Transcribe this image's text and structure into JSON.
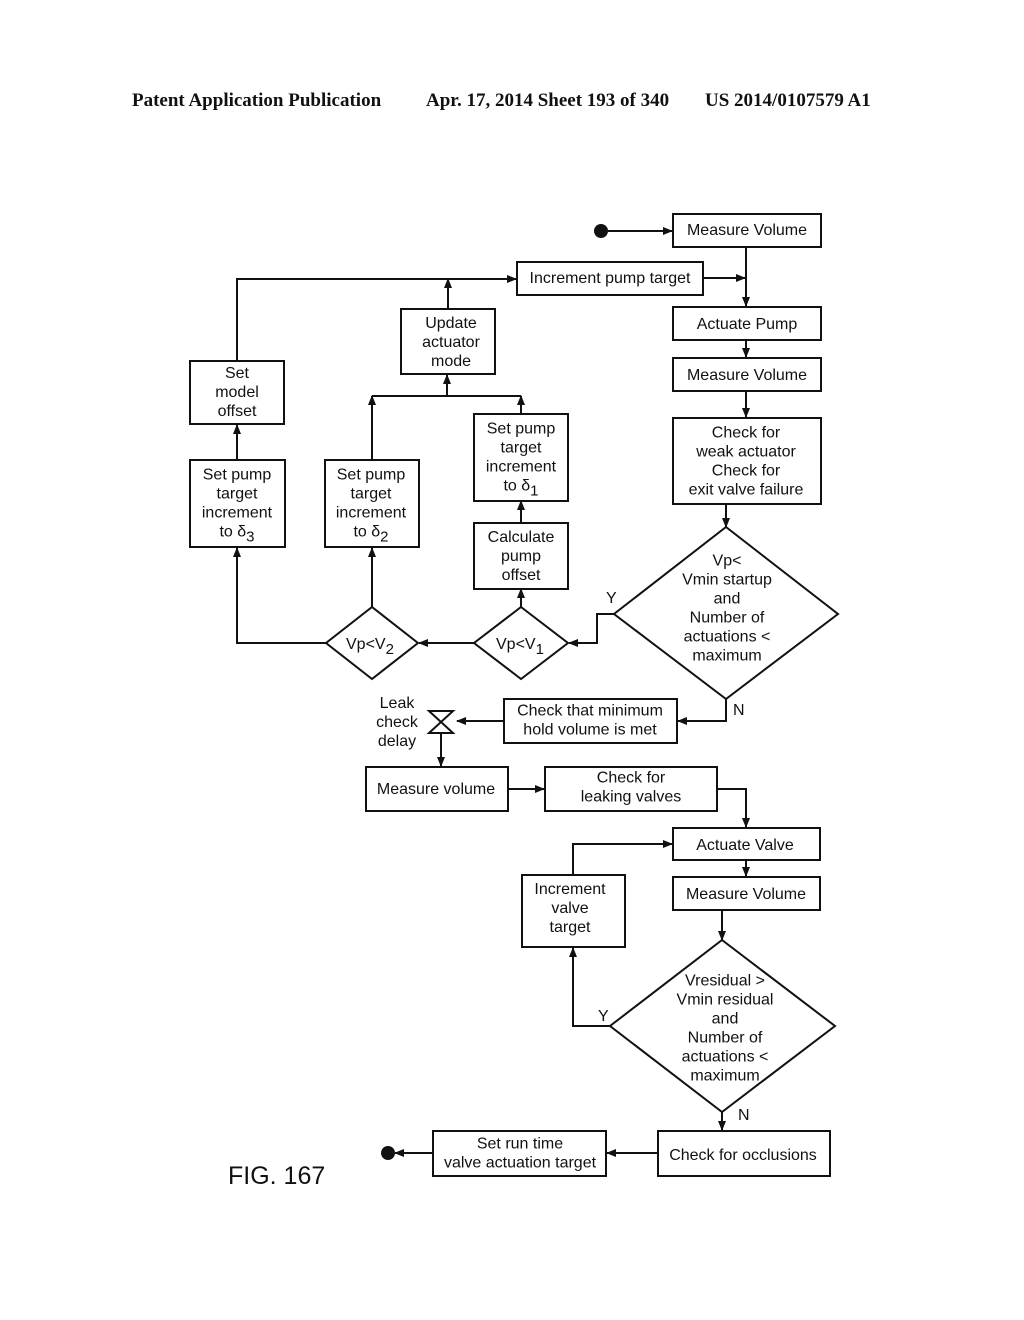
{
  "header": {
    "publication": "Patent Application Publication",
    "date_sheet": "Apr. 17, 2014  Sheet 193 of 340",
    "number": "US 2014/0107579 A1"
  },
  "figure_label": "FIG. 167",
  "nodes": {
    "measure_volume_1": [
      "Measure Volume"
    ],
    "increment_pump_target": [
      "Increment pump target"
    ],
    "actuate_pump": [
      "Actuate Pump"
    ],
    "measure_volume_2": [
      "Measure Volume"
    ],
    "check_weak_actuator": [
      "Check for",
      "weak actuator",
      "Check for",
      "exit valve failure"
    ],
    "decision_startup": [
      "Vp<",
      "Vmin startup",
      "and",
      "Number of",
      "actuations <",
      "maximum"
    ],
    "decision_v1": {
      "base": "Vp<V",
      "sub": "1"
    },
    "decision_v2": {
      "base": "Vp<V",
      "sub": "2"
    },
    "calculate_pump_offset": [
      "Calculate",
      "pump",
      "offset"
    ],
    "set_increment_d1": {
      "lines": [
        "Set pump",
        "target",
        "increment"
      ],
      "last": "to δ",
      "sub": "1"
    },
    "set_increment_d2": {
      "lines": [
        "Set pump",
        "target",
        "increment"
      ],
      "last": "to δ",
      "sub": "2"
    },
    "set_increment_d3": {
      "lines": [
        "Set pump",
        "target",
        "increment"
      ],
      "last": "to δ",
      "sub": "3"
    },
    "update_actuator_mode": [
      "Update",
      "actuator",
      "mode"
    ],
    "set_model_offset": [
      "Set",
      "model",
      "offset"
    ],
    "check_min_hold": [
      "Check that minimum",
      "hold volume is met"
    ],
    "leak_check_delay": [
      "Leak",
      "check",
      "delay"
    ],
    "measure_volume_3": [
      "Measure volume"
    ],
    "check_leaking_valves": [
      "Check for",
      "leaking valves"
    ],
    "actuate_valve": [
      "Actuate Valve"
    ],
    "measure_volume_4": [
      "Measure Volume"
    ],
    "increment_valve_target": [
      "Increment",
      "valve",
      "target"
    ],
    "decision_residual": [
      "Vresidual >",
      "Vmin residual",
      "and",
      "Number of",
      "actuations <",
      "maximum"
    ],
    "check_occlusions": [
      "Check for occlusions"
    ],
    "set_run_time": [
      "Set run time",
      "valve actuation target"
    ]
  },
  "edge_labels": {
    "startup_yes": "Y",
    "startup_no": "N",
    "residual_yes": "Y",
    "residual_no": "N"
  }
}
